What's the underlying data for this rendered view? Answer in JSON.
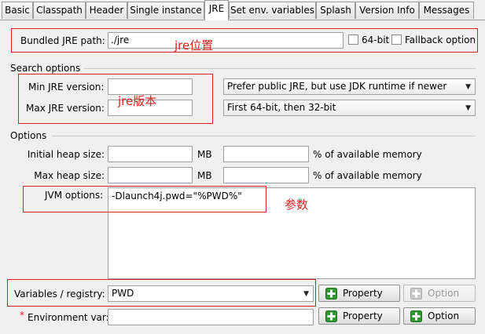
{
  "tabs": [
    "Basic",
    "Classpath",
    "Header",
    "Single instance",
    "JRE",
    "Set env. variables",
    "Splash",
    "Version Info",
    "Messages"
  ],
  "active_tab": "JRE",
  "bundled": {
    "label": "Bundled JRE path:",
    "value": "./jre",
    "bit64_label": "64-bit",
    "fallback_label": "Fallback option"
  },
  "search": {
    "section_label": "Search options",
    "min_label": "Min JRE version:",
    "max_label": "Max JRE version:",
    "min_value": "",
    "max_value": "",
    "preference_select": "Prefer public JRE, but use JDK runtime if newer",
    "arch_select": "First 64-bit, then 32-bit"
  },
  "options": {
    "section_label": "Options",
    "initial_heap_label": "Initial heap size:",
    "max_heap_label": "Max heap size:",
    "mb_label": "MB",
    "percent_label": "% of available memory",
    "jvm_label": "JVM options:",
    "jvm_value": "-Dlaunch4j.pwd=\"%PWD%\""
  },
  "variables": {
    "label": "Variables / registry:",
    "selected": "PWD",
    "property_button": "Property",
    "option_button": "Option"
  },
  "env": {
    "asterisk": "*",
    "label": "Environment var:",
    "value": "",
    "property_button": "Property",
    "option_button": "Option"
  },
  "annotations": {
    "jre_location": "jre位置",
    "jre_version": "jre版本",
    "params": "参数"
  },
  "colors": {
    "annotation_red": "#e02020",
    "plus_green": "#2e9b2e"
  }
}
